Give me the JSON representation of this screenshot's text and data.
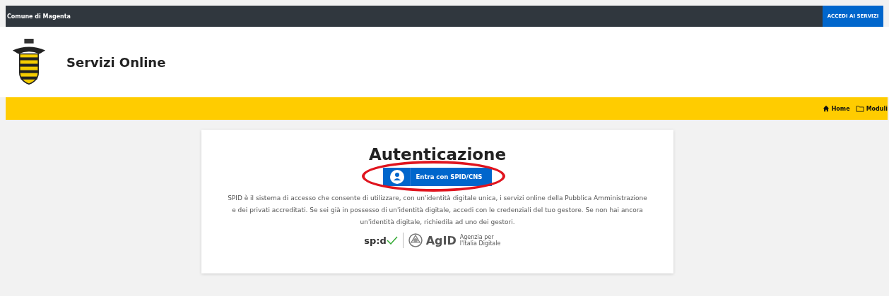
{
  "top_bar": {
    "site_name": "Comune di Magenta",
    "login_button": "ACCEDI AI SERVIZI"
  },
  "header": {
    "title": "Servizi Online"
  },
  "breadcrumb": [
    {
      "label": "Home",
      "kind": "home"
    },
    {
      "label": "Moduli",
      "kind": "folder"
    }
  ],
  "card": {
    "title": "Autenticazione",
    "button": "Entra con SPID/CNS",
    "highlighted": true,
    "text": "SPID è il sistema di accesso che consente di utilizzare, con un'identità digitale unica, i servizi online della Pubblica Amministrazione e dei privati accreditati. Se sei già in possesso di un'identità digitale, accedi con le credenziali del tuo gestore. Se non hai ancora un'identità digitale, richiedila ad uno dei gestori.",
    "logos": {
      "spid": "sp:d",
      "agid": "AgID",
      "agid_sub": "Agenzia per l'Italia Digitale"
    }
  }
}
